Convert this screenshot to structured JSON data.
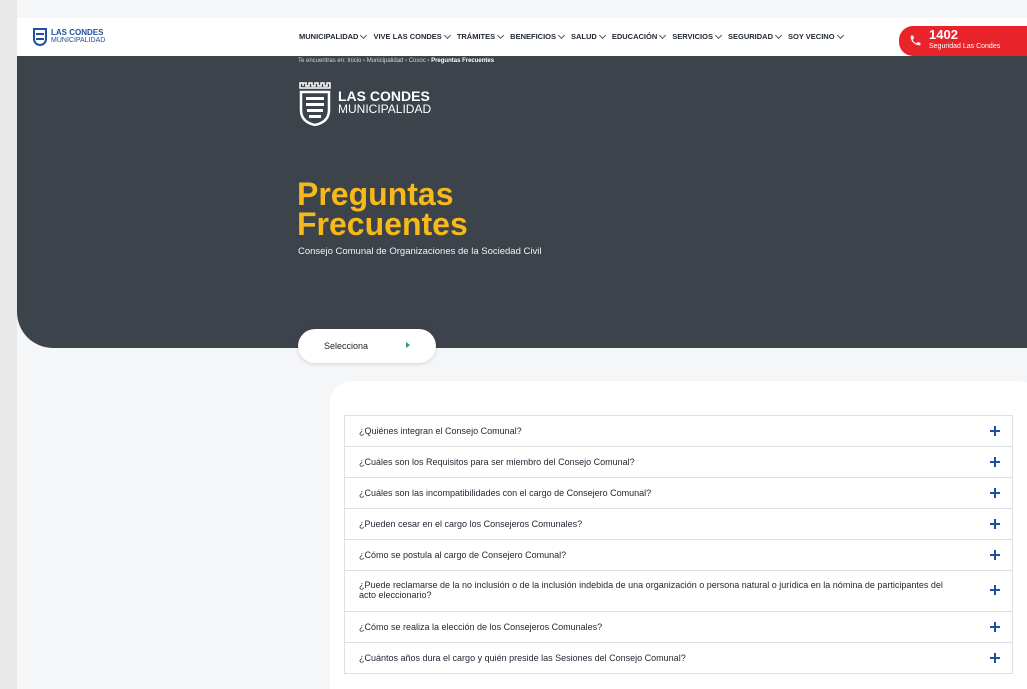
{
  "header": {
    "logo": {
      "name": "LAS CONDES",
      "sub": "MUNICIPALIDAD"
    },
    "nav": [
      "MUNICIPALIDAD",
      "VIVE LAS CONDES",
      "TRÁMITES",
      "BENEFICIOS",
      "SALUD",
      "EDUCACIÓN",
      "SERVICIOS",
      "SEGURIDAD",
      "SOY VECINO"
    ],
    "emergency": {
      "number": "1402",
      "label": "Seguridad Las Condes",
      "color": "#e8232a"
    }
  },
  "hero": {
    "breadcrumb_prefix": "Te encuentras en: Inicio › Municipalidad › Cosoc › ",
    "breadcrumb_current": "Preguntas Frecuentes",
    "logo": {
      "name": "LAS CONDES",
      "sub": "MUNICIPALIDAD"
    },
    "title_line1": "Preguntas",
    "title_line2": "Frecuentes",
    "subtitle": "Consejo Comunal de Organizaciones de la Sociedad Civil",
    "title_color": "#f6b91b",
    "background": "#3c434b"
  },
  "selector": {
    "label": "Selecciona",
    "arrow_icon": "chevron-right-icon"
  },
  "faq": [
    "¿Quiénes integran el Consejo Comunal?",
    "¿Cuáles son los Requisitos para ser miembro del Consejo Comunal?",
    "¿Cuáles son las incompatibilidades con el cargo de Consejero Comunal?",
    "¿Pueden cesar en el cargo los Consejeros Comunales?",
    "¿Cómo se postula al cargo de Consejero Comunal?",
    "¿Puede reclamarse de la no inclusión o de la inclusión indebida de una organización o persona natural o jurídica en la nómina de participantes del acto eleccionario?",
    "¿Cómo se realiza la elección de los Consejeros Comunales?",
    "¿Cuántos años dura el cargo y quién preside las Sesiones del Consejo Comunal?"
  ]
}
